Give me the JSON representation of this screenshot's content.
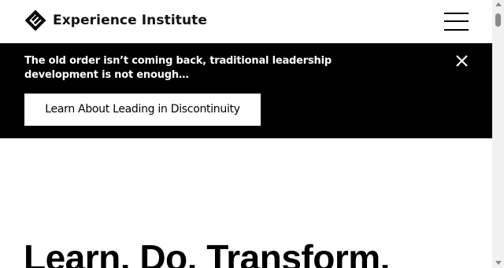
{
  "header": {
    "brand_name": "Experience Institute",
    "logo_icon": "experience-institute-logo",
    "menu_icon": "hamburger-menu-icon"
  },
  "banner": {
    "message": "The old order isn’t coming back, traditional leadership development is not enough…",
    "cta_label": "Learn About Leading in Discontinuity",
    "close_icon": "close-icon",
    "background_color": "#000000",
    "text_color": "#ffffff"
  },
  "hero": {
    "title": "Learn. Do. Transform."
  },
  "scrollbar": {
    "up_icon": "scroll-up-arrow",
    "down_icon": "scroll-down-arrow"
  }
}
